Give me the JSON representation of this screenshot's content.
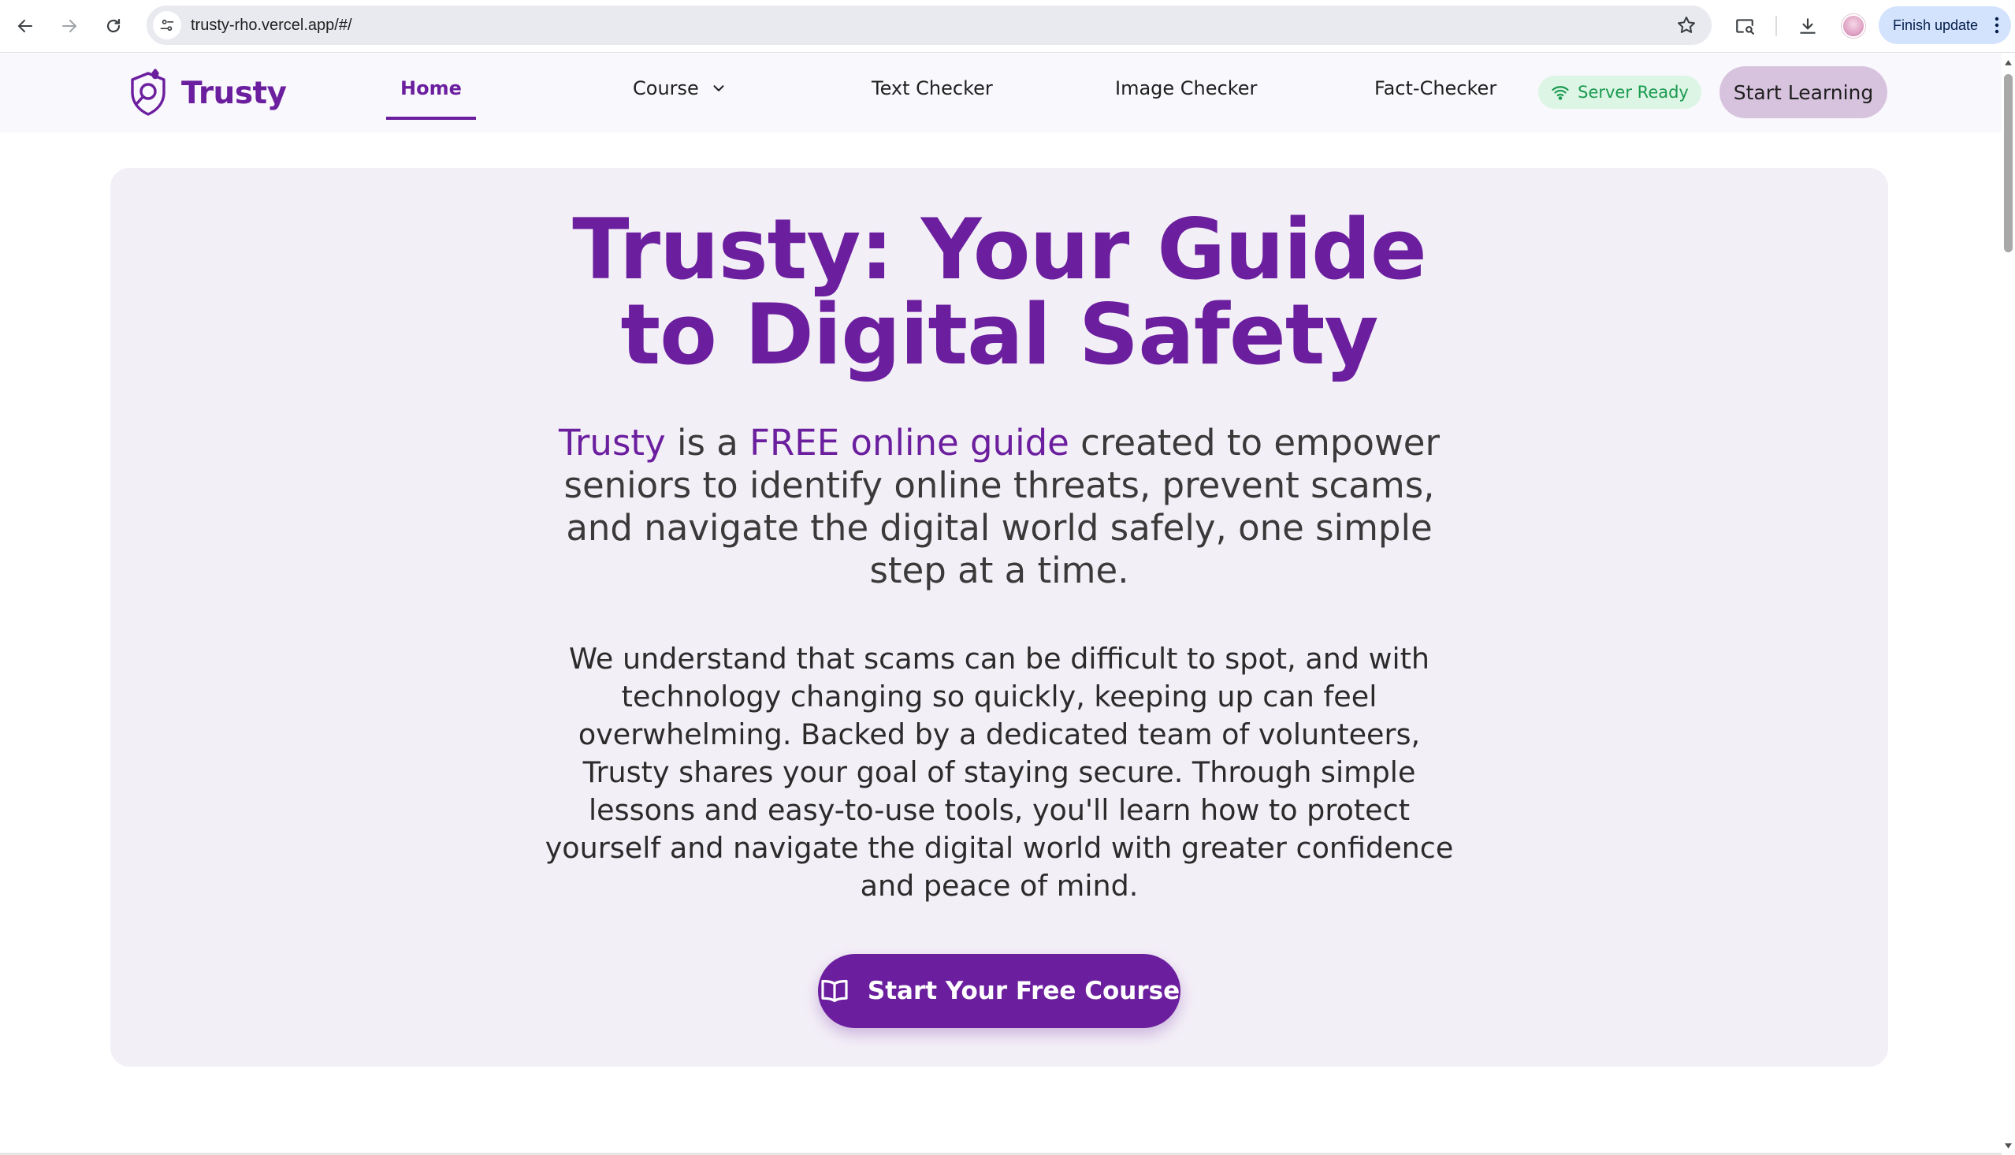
{
  "browser": {
    "url": "trusty-rho.vercel.app/#/",
    "finish_update_label": "Finish update"
  },
  "header": {
    "brand": "Trusty",
    "nav": {
      "home": "Home",
      "course": "Course",
      "text_checker": "Text Checker",
      "image_checker": "Image Checker",
      "fact_checker": "Fact-Checker"
    },
    "active_nav": "Home",
    "server_status": "Server Ready",
    "server_status_color": "#1a9a4f",
    "start_learning": "Start Learning"
  },
  "hero": {
    "title_line1": "Trusty: Your Guide",
    "title_line2": "to Digital Safety",
    "lead": {
      "brand": "Trusty",
      "is_a": " is a ",
      "highlight": "FREE online guide",
      "rest": " created to empower seniors to identify online threats, prevent scams, and navigate the digital world safely, one simple step at a time."
    },
    "body": "We understand that scams can be difficult to spot, and with technology changing so quickly, keeping up can feel overwhelming. Backed by a dedicated team of volunteers, Trusty shares your goal of staying secure. Through simple lessons and easy-to-use tools, you'll learn how to protect yourself and navigate the digital world with greater confidence and peace of mind.",
    "cta_label": "Start Your Free Course",
    "cta_icon": "book-open-icon"
  },
  "colors": {
    "brand_purple": "#6b1f9e",
    "hero_background": "#f3eff7",
    "start_learning_bg": "#d8c3df",
    "server_badge_bg": "#dcf5e5"
  }
}
